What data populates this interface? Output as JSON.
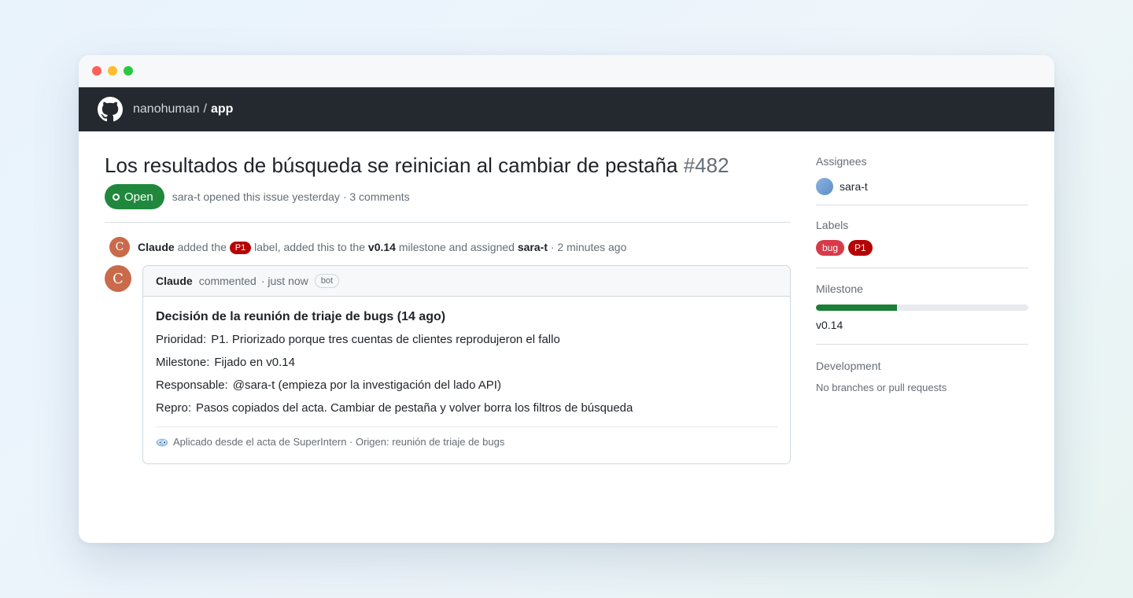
{
  "window": {
    "controls": {
      "close_color": "#ff5f57",
      "minimize_color": "#febc2e",
      "maximize_color": "#28c840"
    }
  },
  "nav": {
    "logo_icon": "github-icon",
    "owner": "nanohuman",
    "separator": "/",
    "repo": "app"
  },
  "issue": {
    "title": "Los resultados de búsqueda se reinician al cambiar de pestaña",
    "number": "#482",
    "state": "Open",
    "state_color": "#1f883d",
    "meta": "sara-t opened this issue yesterday · 3 comments"
  },
  "event": {
    "avatar_letter": "C",
    "actor": "Claude",
    "text_1": "added the",
    "label": "P1",
    "text_2": "label, added this to the",
    "milestone": "v0.14",
    "text_3": "milestone and assigned",
    "assignee": "sara-t",
    "time": "· 2 minutes ago"
  },
  "comment": {
    "avatar_letter": "C",
    "author": "Claude",
    "action": "commented",
    "time": "· just now",
    "badge": "bot",
    "heading": "Decisión de la reunión de triaje de bugs (14 ago)",
    "fields": [
      {
        "key": "Prioridad:",
        "value": "P1. Priorizado porque tres cuentas de clientes reprodujeron el fallo"
      },
      {
        "key": "Milestone:",
        "value": "Fijado en v0.14"
      },
      {
        "key": "Responsable:",
        "value": "@sara-t (empieza por la investigación del lado API)"
      },
      {
        "key": "Repro:",
        "value": "Pasos copiados del acta. Cambiar de pestaña y volver borra los filtros de búsqueda"
      }
    ],
    "footer_icon": "superintern-icon",
    "footer": "Aplicado desde el acta de SuperIntern · Origen: reunión de triaje de bugs"
  },
  "sidebar": {
    "assignees_title": "Assignees",
    "assignee": "sara-t",
    "labels_title": "Labels",
    "labels": [
      {
        "name": "bug",
        "color": "#d73a4a"
      },
      {
        "name": "P1",
        "color": "#b60205"
      }
    ],
    "milestone_title": "Milestone",
    "milestone_progress_pct": 38,
    "milestone_name": "v0.14",
    "development_title": "Development",
    "development_text": "No branches or pull requests"
  }
}
